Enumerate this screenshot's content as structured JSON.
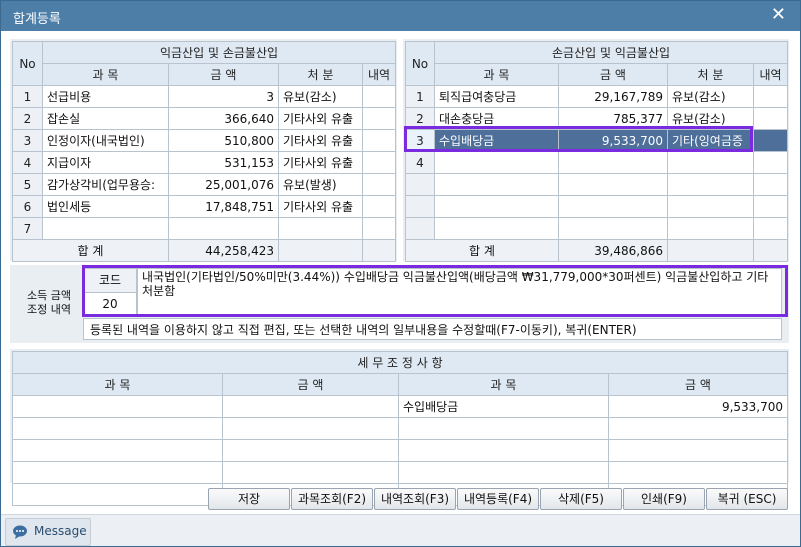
{
  "window": {
    "title": "합계등록",
    "close_icon": "✕"
  },
  "left_table": {
    "header_group": "익금산입 및 손금불산입",
    "col_no": "No",
    "col_subject": "과 목",
    "col_amount": "금 액",
    "col_disposal": "처 분",
    "col_detail": "내역",
    "rows": [
      {
        "no": "1",
        "subject": "선급비용",
        "amount": "3",
        "disposal": "유보(감소)"
      },
      {
        "no": "2",
        "subject": "잡손실",
        "amount": "366,640",
        "disposal": "기타사외 유출"
      },
      {
        "no": "3",
        "subject": "인정이자(내국법인)",
        "amount": "510,800",
        "disposal": "기타사외 유출"
      },
      {
        "no": "4",
        "subject": "지급이자",
        "amount": "531,153",
        "disposal": "기타사외 유출"
      },
      {
        "no": "5",
        "subject": "감가상각비(업무용승:",
        "amount": "25,001,076",
        "disposal": "유보(발생)"
      },
      {
        "no": "6",
        "subject": "법인세등",
        "amount": "17,848,751",
        "disposal": "기타사외 유출"
      },
      {
        "no": "7",
        "subject": "",
        "amount": "",
        "disposal": ""
      }
    ],
    "total_label": "합 계",
    "total_amount": "44,258,423"
  },
  "right_table": {
    "header_group": "손금산입 및 익금불산입",
    "col_no": "No",
    "col_subject": "과 목",
    "col_amount": "금 액",
    "col_disposal": "처 분",
    "col_detail": "내역",
    "rows": [
      {
        "no": "1",
        "subject": "퇴직급여충당금",
        "amount": "29,167,789",
        "disposal": "유보(감소)"
      },
      {
        "no": "2",
        "subject": "대손충당금",
        "amount": "785,377",
        "disposal": "유보(감소)"
      },
      {
        "no": "3",
        "subject": "수입배당금",
        "amount": "9,533,700",
        "disposal": "기타(잉여금증"
      },
      {
        "no": "4",
        "subject": "",
        "amount": "",
        "disposal": ""
      }
    ],
    "total_label": "합 계",
    "total_amount": "39,486,866"
  },
  "adjustment": {
    "label_line1": "소득 금액",
    "label_line2": "조정 내역",
    "code_header": "코드",
    "code_value": "20",
    "description": "내국법인(기타법인/50%미만(3.44%)) 수입배당금 익금불산입액(배당금액 ₩31,779,000*30퍼센트) 익금불산입하고 기타처분함",
    "hint": "등록된 내역을 이용하지 않고 직접 편집, 또는 선택한 내역의 일부내용을 수정할때(F7-이동키), 복귀(ENTER)"
  },
  "tax_adjustment": {
    "title": "세 무 조 정 사 항",
    "col_subject1": "과  목",
    "col_amount1": "금  액",
    "col_subject2": "과  목",
    "col_amount2": "금  액",
    "rows": [
      {
        "s1": "",
        "a1": "",
        "s2": "수입배당금",
        "a2": "9,533,700"
      },
      {
        "s1": "",
        "a1": "",
        "s2": "",
        "a2": ""
      },
      {
        "s1": "",
        "a1": "",
        "s2": "",
        "a2": ""
      },
      {
        "s1": "",
        "a1": "",
        "s2": "",
        "a2": ""
      },
      {
        "s1": "",
        "a1": "",
        "s2": "",
        "a2": ""
      }
    ]
  },
  "buttons": {
    "save": "저장",
    "subject_lookup": "과목조회(F2)",
    "detail_lookup": "내역조회(F3)",
    "detail_register": "내역등록(F4)",
    "delete": "삭제(F5)",
    "print": "인쇄(F9)",
    "return": "복귀 (ESC)"
  },
  "status": {
    "message_label": "Message",
    "message_icon": "speech-bubble"
  },
  "colors": {
    "titlebar": "#4d7ea8",
    "selected_row": "#4d6f9a",
    "highlight_border": "#7a2be0"
  }
}
